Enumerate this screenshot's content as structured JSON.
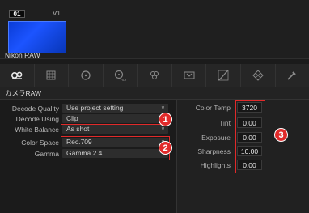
{
  "clip": {
    "number": "01",
    "track": "V1",
    "name": "Nikon RAW"
  },
  "toolbar": {
    "tools": [
      "camera-raw",
      "color-match",
      "color-wheels",
      "hdr-wheels",
      "rgb-mixer",
      "motion-effects",
      "curves",
      "color-warper",
      "qualifier"
    ]
  },
  "section": {
    "title": "カメラRAW"
  },
  "left": {
    "rows": [
      {
        "label": "Decode Quality",
        "value": "Use project setting"
      },
      {
        "label": "Decode Using",
        "value": "Clip"
      },
      {
        "label": "White Balance",
        "value": "As shot"
      },
      {
        "label": "Color Space",
        "value": "Rec.709"
      },
      {
        "label": "Gamma",
        "value": "Gamma 2.4"
      }
    ]
  },
  "right": {
    "rows": [
      {
        "label": "Color Temp",
        "value": "3720"
      },
      {
        "label": "Tint",
        "value": "0.00"
      },
      {
        "label": "Exposure",
        "value": "0.00"
      },
      {
        "label": "Sharpness",
        "value": "10.00"
      },
      {
        "label": "Highlights",
        "value": "0.00"
      }
    ]
  },
  "markers": [
    "1",
    "2",
    "3"
  ],
  "colors": {
    "marker": "#e12a2a",
    "clip_accent": "#1c54ff"
  }
}
